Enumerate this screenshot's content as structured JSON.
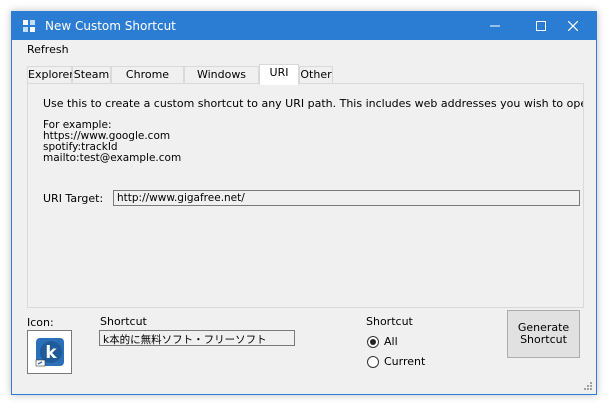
{
  "window": {
    "title": "New Custom Shortcut",
    "icon": "app-logo-icon"
  },
  "menu": {
    "items": [
      "Refresh"
    ]
  },
  "tabs": [
    {
      "label": "Explorer",
      "active": false
    },
    {
      "label": "Steam",
      "active": false
    },
    {
      "label": "Chrome Apps",
      "active": false
    },
    {
      "label": "Windows Store",
      "active": false
    },
    {
      "label": "URI",
      "active": true
    },
    {
      "label": "Other",
      "active": false
    }
  ],
  "uri_panel": {
    "description": "Use this to create a custom shortcut to any URI path. This includes web addresses you wish to open in the default br",
    "example_heading": "For example:",
    "examples": [
      "https://www.google.com",
      "spotify:trackId",
      "mailto:test@example.com"
    ],
    "target_label": "URI Target:",
    "target_value": "http://www.gigafree.net/"
  },
  "bottom": {
    "icon_label": "Icon:",
    "shortcut_label": "Shortcut",
    "shortcut_value": "k本的に無料ソフト・フリーソフト",
    "radio_group_label": "Shortcut",
    "radio_all": "All",
    "radio_current": "Current",
    "selected": "All",
    "generate_line1": "Generate",
    "generate_line2": "Shortcut"
  },
  "colors": {
    "titlebar": "#2b7cd3",
    "window_bg": "#f0f0f0"
  }
}
